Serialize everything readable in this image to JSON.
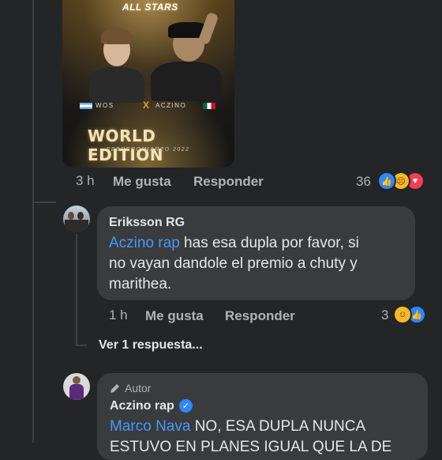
{
  "post": {
    "poster": {
      "top_text": "ALL STARS",
      "name_left": "WOS",
      "name_right": "ACZINO",
      "versus": "X",
      "edition": "WORLD EDITION",
      "dates": "FEBRERO/MARZO 2022"
    },
    "comment_actions": {
      "time": "3 h",
      "like": "Me gusta",
      "reply": "Responder",
      "reaction_count": "36"
    }
  },
  "comments": [
    {
      "author": "Eriksson RG",
      "mention": "Aczino rap",
      "text_line1": " has esa dupla por favor, si",
      "text_line2": "no vayan dandole el premio a chuty y",
      "text_line3": "marithea.",
      "time": "1 h",
      "like": "Me gusta",
      "reply": "Responder",
      "reaction_count": "3",
      "view_replies": "Ver 1 respuesta..."
    },
    {
      "badge": "Autor",
      "author": "Aczino rap",
      "mention": "Marco Nava",
      "text_line1": " NO, ESA DUPLA NUNCA",
      "text_line2": "ESTUVO EN PLANES IGUAL QUE LA DE"
    }
  ],
  "icons": {
    "like_color": "#2d88ff",
    "sad_color": "#f7b928",
    "love_color": "#f33e58",
    "haha_color": "#f7b928"
  }
}
